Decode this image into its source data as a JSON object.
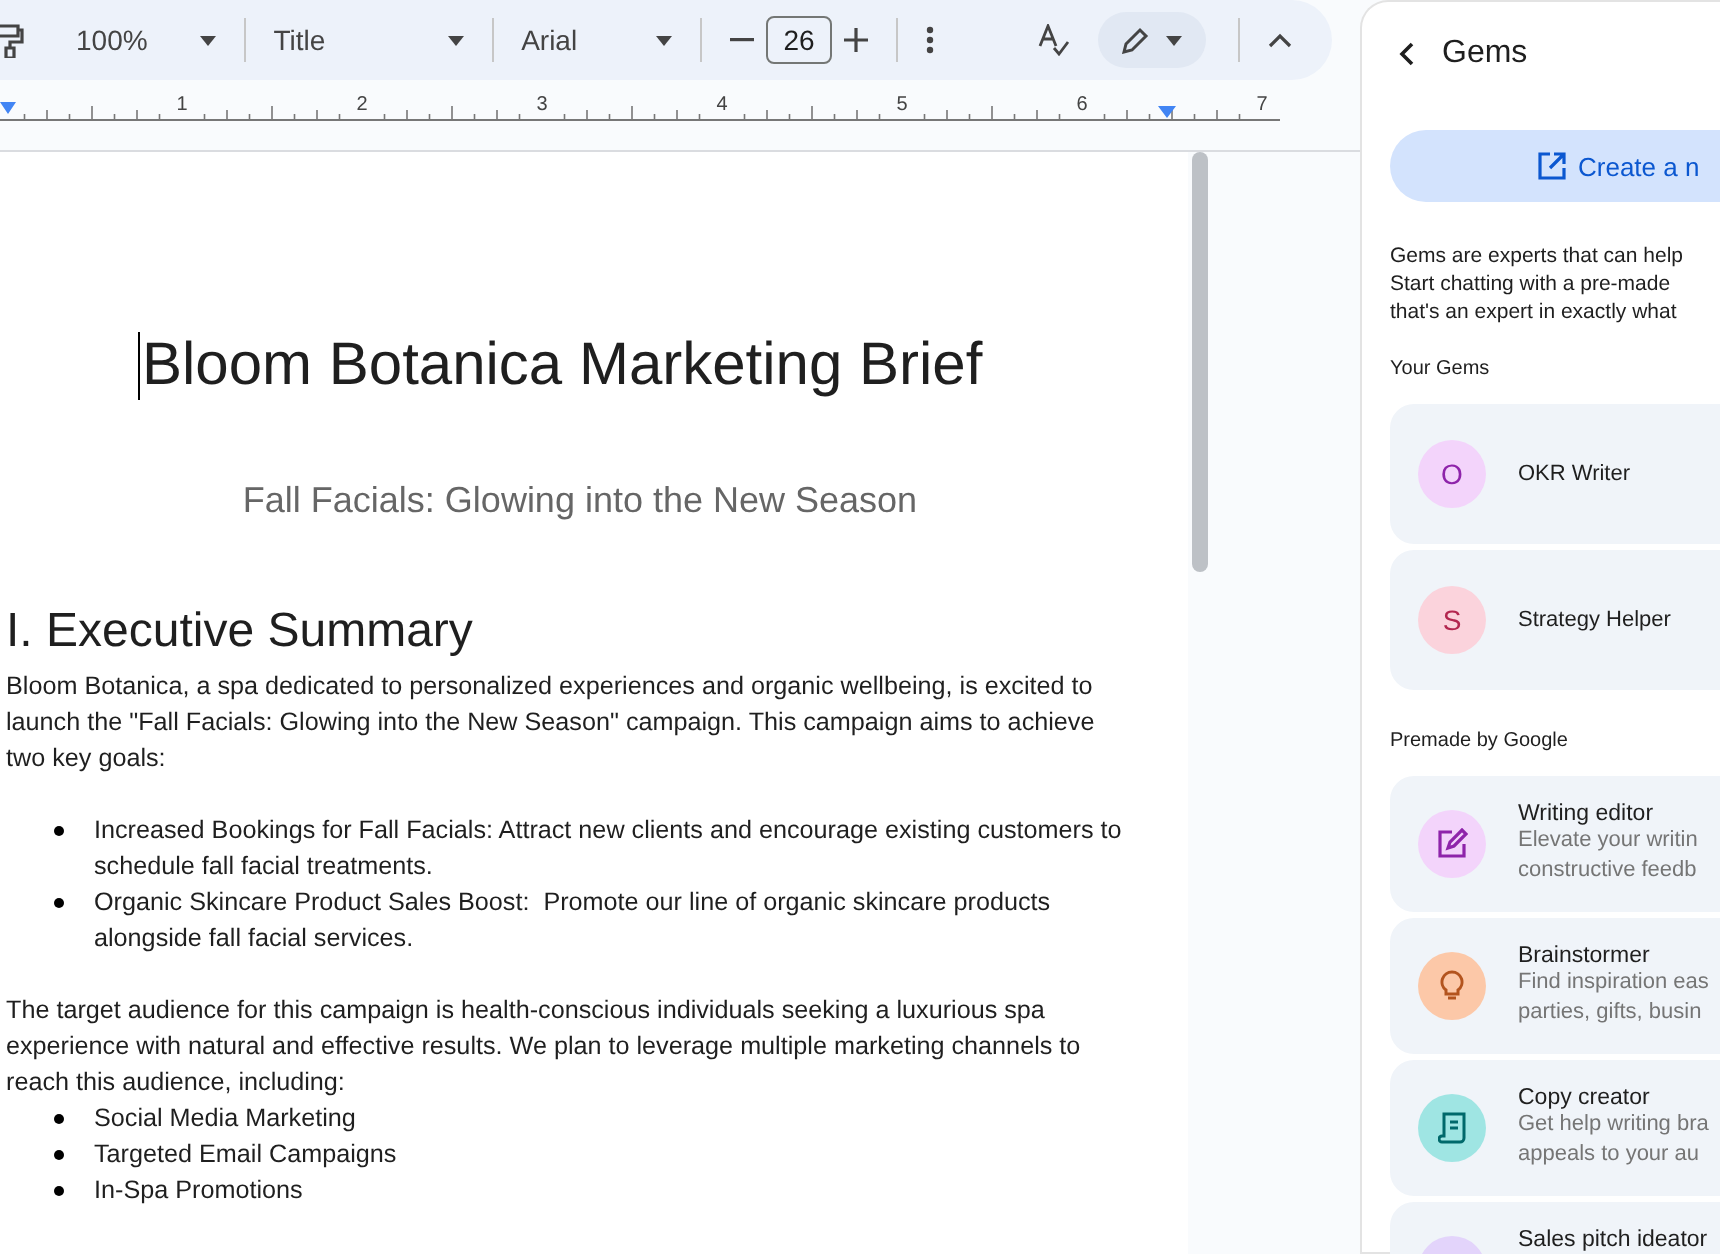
{
  "toolbar": {
    "zoom": "100%",
    "style": "Title",
    "font": "Arial",
    "font_size": "26"
  },
  "ruler": {
    "labels": [
      "1",
      "2",
      "3",
      "4",
      "5",
      "6",
      "7"
    ]
  },
  "document": {
    "title": "Bloom Botanica Marketing Brief",
    "subtitle": "Fall Facials: Glowing into the New Season",
    "heading": "I. Executive Summary",
    "blocks": [
      {
        "kind": "paragraph",
        "text": "Bloom Botanica, a spa dedicated to personalized experiences and organic wellbeing, is excited to launch the \"Fall Facials: Glowing into the New Season\" campaign. This campaign aims to achieve two key goals:"
      },
      {
        "kind": "bullets",
        "items": [
          "Increased Bookings for Fall Facials: Attract new clients and encourage existing customers to schedule fall facial treatments.",
          "Organic Skincare Product Sales Boost:  Promote our line of organic skincare products alongside fall facial services."
        ]
      },
      {
        "kind": "paragraph",
        "text": "The target audience for this campaign is health-conscious individuals seeking a luxurious spa experience with natural and effective results. We plan to leverage multiple marketing channels to reach this audience, including:"
      },
      {
        "kind": "tight_bullets",
        "items": [
          "Social Media Marketing",
          "Targeted Email Campaigns",
          "In-Spa Promotions"
        ]
      }
    ]
  },
  "panel": {
    "title": "Gems",
    "create_button": "Create a n",
    "intro": [
      "Gems are experts that can help",
      "Start chatting with a pre-made",
      "that's an expert in exactly what"
    ],
    "your_gems_label": "Your Gems",
    "your_gems": [
      {
        "letter": "O",
        "name": "OKR Writer",
        "color": "#f3d4fb"
      },
      {
        "letter": "S",
        "name": "Strategy Helper",
        "color": "#fbd3dc"
      }
    ],
    "premade_label": "Premade by Google",
    "premade": [
      {
        "name": "Writing editor",
        "lines": [
          "Elevate your writin",
          "constructive feedb"
        ],
        "color": "#f3d4fb"
      },
      {
        "name": "Brainstormer",
        "lines": [
          "Find inspiration eas",
          "parties, gifts, busin"
        ],
        "color": "#fcc8a8"
      },
      {
        "name": "Copy creator",
        "lines": [
          "Get help writing bra",
          "appeals to your au"
        ],
        "color": "#9fe5e3"
      },
      {
        "name": "Sales pitch ideator",
        "color": "#e3d4fb"
      }
    ]
  }
}
